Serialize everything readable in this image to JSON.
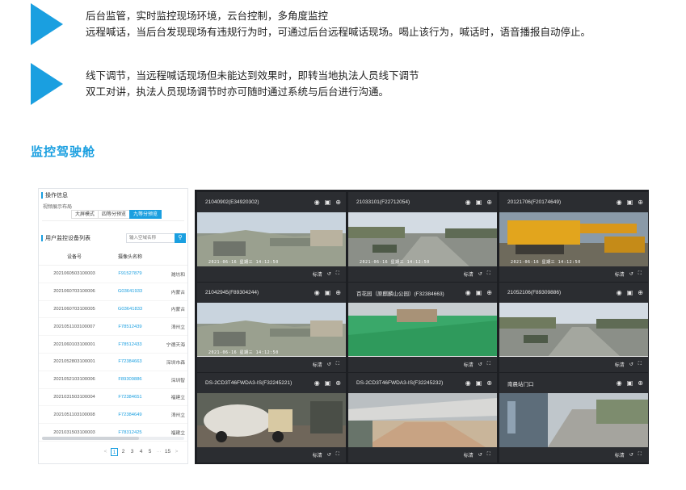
{
  "features": [
    {
      "lines": [
        "后台监管，实时监控现场环境，云台控制，多角度监控",
        "远程喊话，当后台发现现场有违规行为时，可通过后台远程喊话现场。喝止该行为，喊话时，语音播报自动停止。"
      ]
    },
    {
      "lines": [
        "线下调节，当远程喊话现场但未能达到效果时，即转当地执法人员线下调节",
        "双工对讲，执法人员现场调节时亦可随时通过系统与后台进行沟通。"
      ]
    }
  ],
  "section_title": "监控驾驶舱",
  "panel": {
    "ops_title": "操作信息",
    "layout_label": "视频展示布局",
    "layout_options": [
      "大屏模式",
      "四等分预览",
      "九等分预览"
    ],
    "active_layout": "九等分预览",
    "list_title": "用户监控设备列表",
    "search_placeholder": "输入空域名称",
    "search_icon": "search-icon",
    "columns": [
      "设备号",
      "摄像头名称",
      ""
    ],
    "rows": [
      [
        "2021060503100003",
        "F91527879",
        "潍坊和"
      ],
      [
        "2021060703100006",
        "G03641933",
        "内蒙古"
      ],
      [
        "2021060703100005",
        "G03641833",
        "内蒙古"
      ],
      [
        "2021051103100007",
        "F78512439",
        "漳州立"
      ],
      [
        "2021060103100001",
        "F78512433",
        "宁德天海"
      ],
      [
        "2021052803100001",
        "F72384663",
        "深圳市森"
      ],
      [
        "2021052103100006",
        "F89309886",
        "深圳智"
      ],
      [
        "2021031503100004",
        "F72384651",
        "福建立"
      ],
      [
        "2021051103100008",
        "F72384649",
        "漳州立"
      ],
      [
        "2021031503100003",
        "F78312425",
        "福建立"
      ]
    ],
    "pagination": {
      "prev": "<",
      "pages": [
        "1",
        "2",
        "3",
        "4",
        "5"
      ],
      "active": "1",
      "ellipsis": "···",
      "last": "15",
      "next": ">"
    }
  },
  "cameras": [
    {
      "title": "21040902(E34920302)",
      "osd": "2021-06-16 星期三 14:12:50",
      "scene": "site"
    },
    {
      "title": "21033101(F22712054)",
      "osd": "2021-06-16 星期三 14:12:50",
      "scene": "road"
    },
    {
      "title": "20121706(F20174649)",
      "osd": "2021-06-16 星期三 14:12:50",
      "scene": "crane"
    },
    {
      "title": "21042945(F89304244)",
      "osd": "2021-06-16 星期三 14:12:50",
      "scene": "site"
    },
    {
      "title": "百花园（原麒麟山公园）(F32384663)",
      "osd": "",
      "scene": "green"
    },
    {
      "title": "21052106(F89309886)",
      "osd": "",
      "scene": "road"
    },
    {
      "title": "DS-2CD3T46FWDA3-IS(F32245221)",
      "osd": "",
      "scene": "truck"
    },
    {
      "title": "DS-2CD3T46FWDA3-IS(F32245232)",
      "osd": "",
      "scene": "shed"
    },
    {
      "title": "南晨站门口",
      "osd": "",
      "scene": "gate"
    }
  ],
  "cell_controls": {
    "top_icons": [
      "camera-icon",
      "video-icon",
      "zoom-in-icon"
    ],
    "quality_label": "标清",
    "bottom_icons": [
      "playback-icon",
      "fullscreen-icon"
    ]
  },
  "colors": {
    "accent": "#1a9fe0",
    "grid_bg": "#1d1f23",
    "cell_bg": "#2b2d31"
  }
}
